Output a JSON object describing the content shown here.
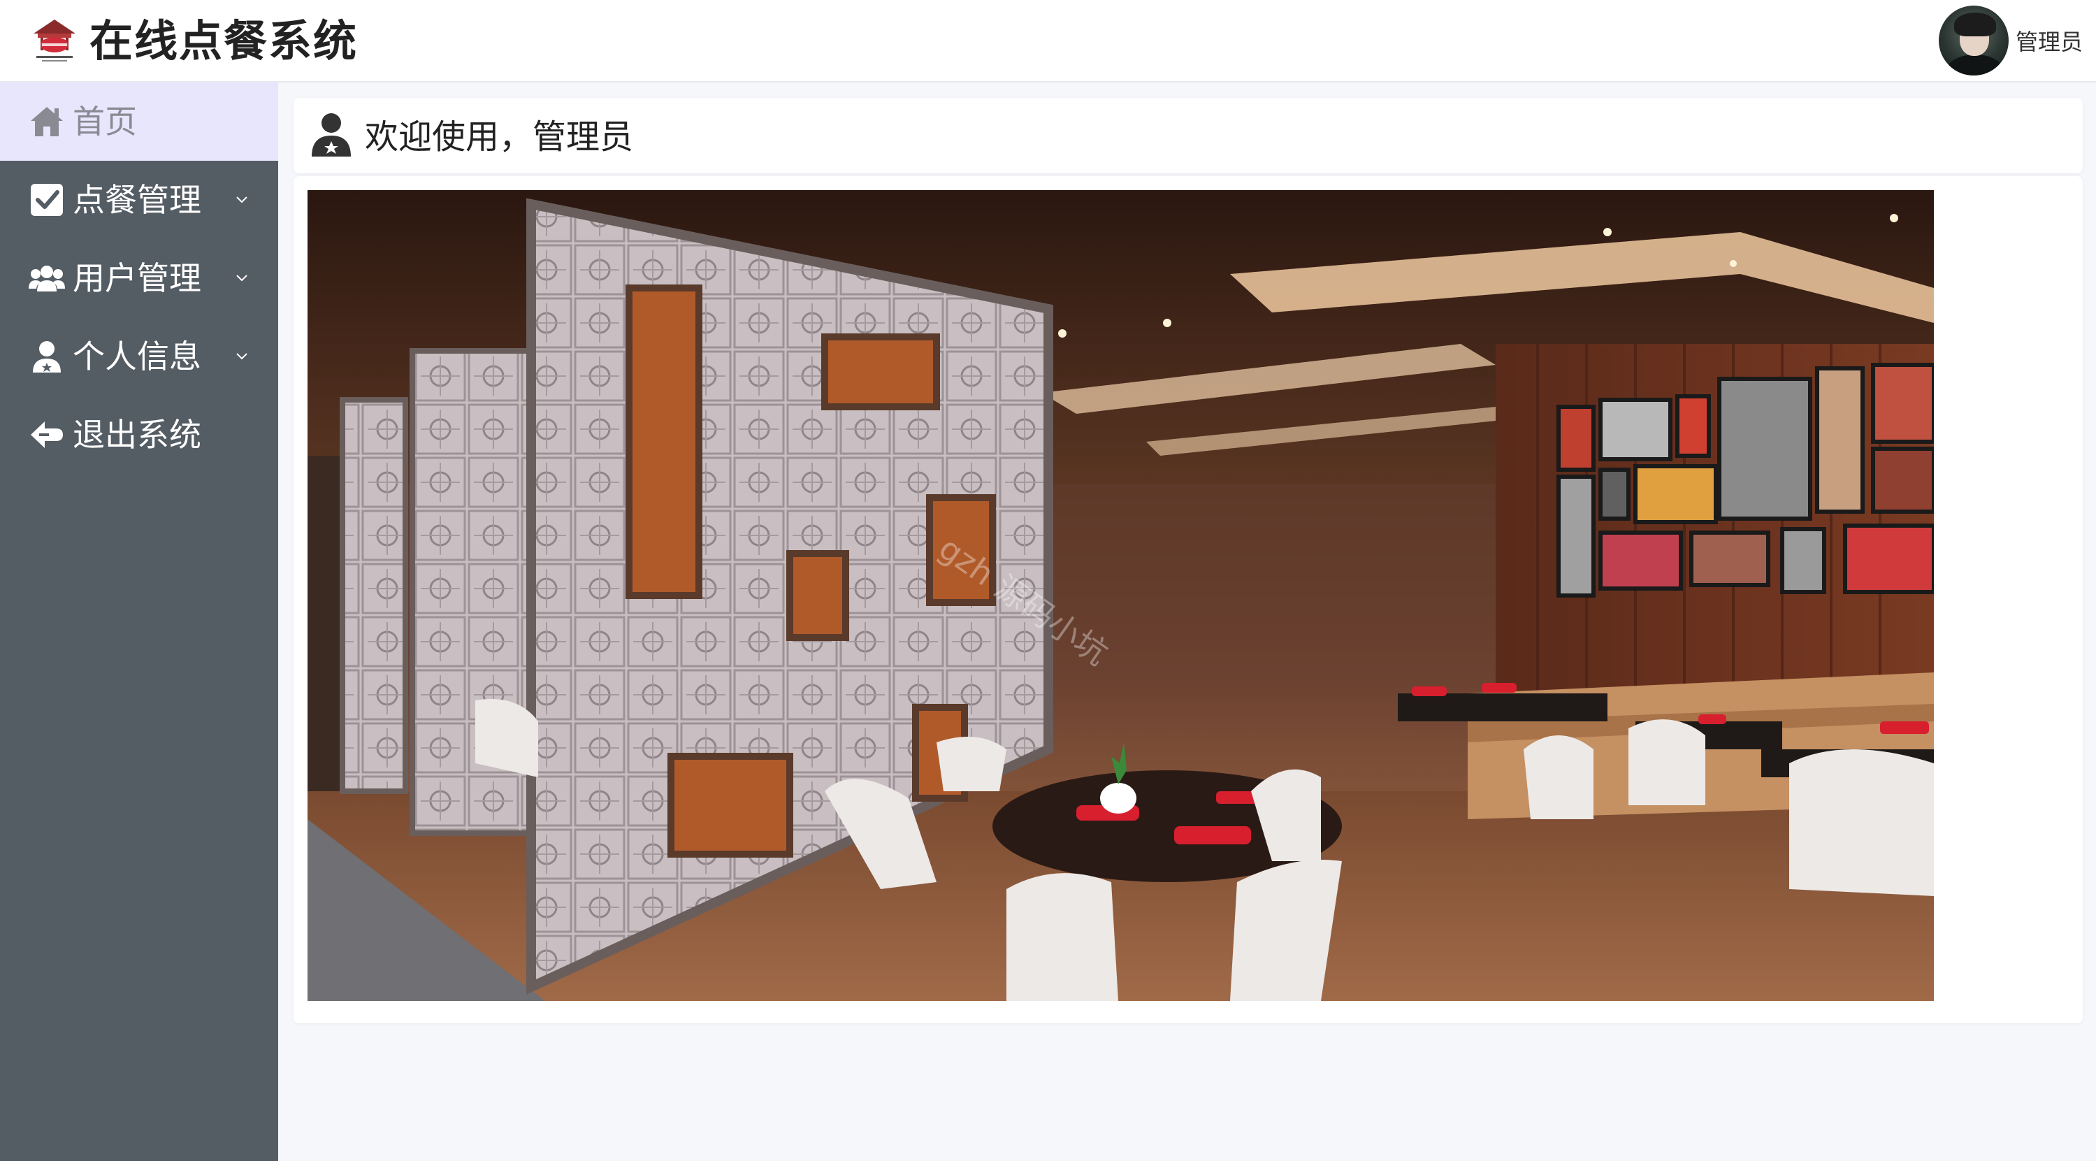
{
  "header": {
    "app_title": "在线点餐系统",
    "user_name": "管理员"
  },
  "sidebar": {
    "items": [
      {
        "label": "首页",
        "icon": "home-icon",
        "active": true,
        "expandable": false
      },
      {
        "label": "点餐管理",
        "icon": "checkbox-icon",
        "active": false,
        "expandable": true
      },
      {
        "label": "用户管理",
        "icon": "users-icon",
        "active": false,
        "expandable": true
      },
      {
        "label": "个人信息",
        "icon": "user-icon",
        "active": false,
        "expandable": true
      },
      {
        "label": "退出系统",
        "icon": "logout-arrow-icon",
        "active": false,
        "expandable": false
      }
    ]
  },
  "main": {
    "welcome_text": "欢迎使用，管理员",
    "welcome_icon": "user-icon",
    "photo_watermark": "gzh 源码小坑"
  },
  "colors": {
    "sidebar_bg": "#545c64",
    "sidebar_active_bg": "#e8e6fd",
    "page_bg": "#f5f7fb",
    "accent_red": "#c0182b"
  }
}
